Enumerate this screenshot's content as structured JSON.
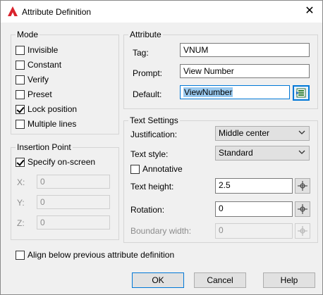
{
  "window": {
    "title": "Attribute Definition",
    "close_glyph": "✕"
  },
  "mode": {
    "label": "Mode",
    "options": [
      {
        "label": "Invisible",
        "checked": false
      },
      {
        "label": "Constant",
        "checked": false
      },
      {
        "label": "Verify",
        "checked": false
      },
      {
        "label": "Preset",
        "checked": false
      },
      {
        "label": "Lock position",
        "checked": true
      },
      {
        "label": "Multiple lines",
        "checked": false
      }
    ]
  },
  "insertion_point": {
    "label": "Insertion Point",
    "specify_on_screen": {
      "label": "Specify on-screen",
      "checked": true
    },
    "x": {
      "label": "X:",
      "value": "0"
    },
    "y": {
      "label": "Y:",
      "value": "0"
    },
    "z": {
      "label": "Z:",
      "value": "0"
    }
  },
  "attribute": {
    "label": "Attribute",
    "tag": {
      "label": "Tag:",
      "value": "VNUM"
    },
    "prompt": {
      "label": "Prompt:",
      "value": "View Number"
    },
    "default": {
      "label": "Default:",
      "value": "ViewNumber"
    }
  },
  "text_settings": {
    "label": "Text Settings",
    "justification": {
      "label": "Justification:",
      "value": "Middle center"
    },
    "text_style": {
      "label": "Text style:",
      "value": "Standard"
    },
    "annotative": {
      "label": "Annotative",
      "checked": false
    },
    "text_height": {
      "label": "Text height:",
      "value": "2.5"
    },
    "rotation": {
      "label": "Rotation:",
      "value": "0"
    },
    "boundary_width": {
      "label": "Boundary width:",
      "value": "0"
    }
  },
  "align_below": {
    "label": "Align below previous attribute definition",
    "checked": false
  },
  "buttons": {
    "ok": "OK",
    "cancel": "Cancel",
    "help": "Help"
  },
  "colors": {
    "accent": "#0078d7",
    "app_icon": "#d9232d",
    "disabled_text": "#8c8c8c"
  },
  "icons": {
    "app": "autocad-logo-icon",
    "close": "close-icon",
    "field": "insert-field-icon",
    "pick": "pick-point-icon",
    "dropdown": "chevron-down-icon"
  }
}
